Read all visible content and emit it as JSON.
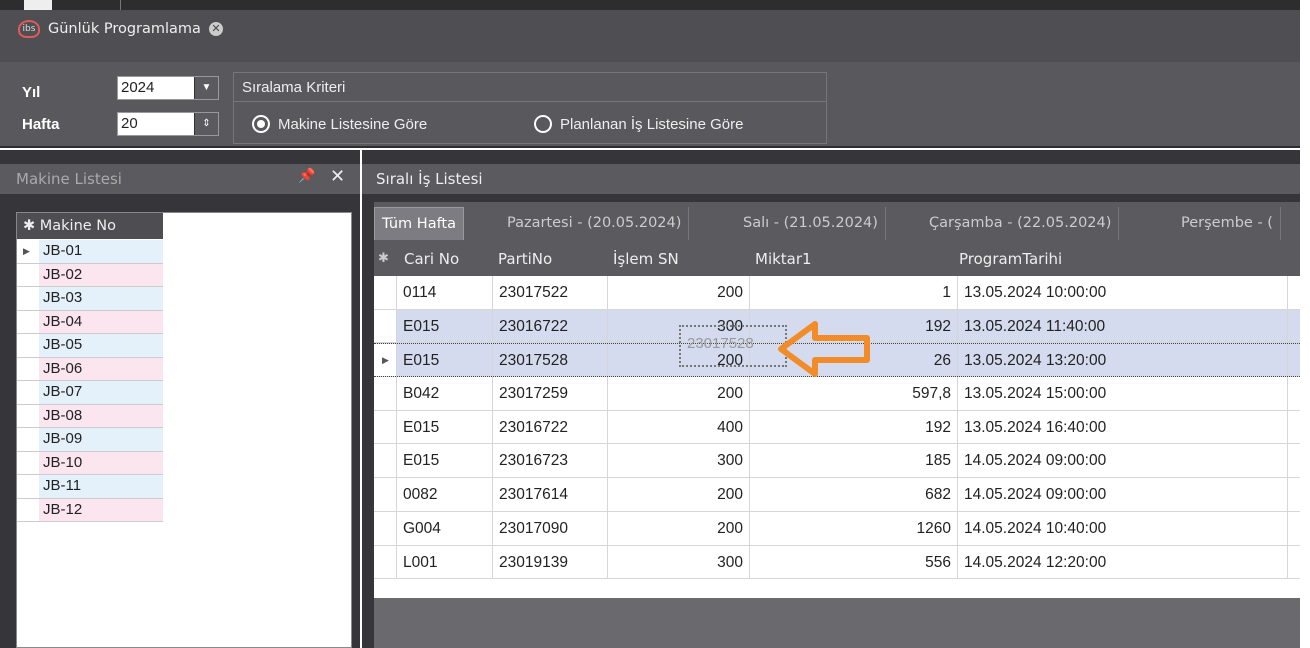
{
  "doc_tab": {
    "logo_text": "ibs",
    "title": "Günlük Programlama",
    "close_glyph": "✕"
  },
  "filters": {
    "year_label": "Yıl",
    "year_value": "2024",
    "week_label": "Hafta",
    "week_value": "20",
    "sort_title": "Sıralama Kriteri",
    "sort_options": [
      {
        "label": "Makine Listesine Göre",
        "selected": true
      },
      {
        "label": "Planlanan İş Listesine Göre",
        "selected": false
      }
    ]
  },
  "machine_panel": {
    "title": "Makine Listesi",
    "column": "Makine No",
    "rows": [
      "JB-01",
      "JB-02",
      "JB-03",
      "JB-04",
      "JB-05",
      "JB-06",
      "JB-07",
      "JB-08",
      "JB-09",
      "JB-10",
      "JB-11",
      "JB-12"
    ]
  },
  "job_panel": {
    "title": "Sıralı İş Listesi",
    "tabs": [
      "Tüm Hafta",
      "Pazartesi - (20.05.2024)",
      "Salı - (21.05.2024)",
      "Çarşamba - (22.05.2024)",
      "Perşembe - ("
    ],
    "columns": [
      "Cari No",
      "PartiNo",
      "İşlem SN",
      "Miktar1",
      "ProgramTarihi"
    ],
    "rows": [
      {
        "cari": "0114",
        "parti": "23017522",
        "islem": "200",
        "miktar": "1",
        "tarih": "13.05.2024 10:00:00"
      },
      {
        "cari": "E015",
        "parti": "23016722",
        "islem": "300",
        "miktar": "192",
        "tarih": "13.05.2024 11:40:00"
      },
      {
        "cari": "E015",
        "parti": "23017528",
        "islem": "200",
        "miktar": "26",
        "tarih": "13.05.2024 13:20:00"
      },
      {
        "cari": "B042",
        "parti": "23017259",
        "islem": "200",
        "miktar": "597,8",
        "tarih": "13.05.2024 15:00:00"
      },
      {
        "cari": "E015",
        "parti": "23016722",
        "islem": "400",
        "miktar": "192",
        "tarih": "13.05.2024 16:40:00"
      },
      {
        "cari": "E015",
        "parti": "23016723",
        "islem": "300",
        "miktar": "185",
        "tarih": "14.05.2024 09:00:00"
      },
      {
        "cari": "0082",
        "parti": "23017614",
        "islem": "200",
        "miktar": "682",
        "tarih": "14.05.2024 09:00:00"
      },
      {
        "cari": "G004",
        "parti": "23017090",
        "islem": "200",
        "miktar": "1260",
        "tarih": "14.05.2024 10:40:00"
      },
      {
        "cari": "L001",
        "parti": "23019139",
        "islem": "300",
        "miktar": "556",
        "tarih": "14.05.2024 12:20:00"
      }
    ],
    "drag_ghost_text": "23017528"
  },
  "colors": {
    "accent_arrow": "#f28c28",
    "logo_ring": "#e05b5b"
  }
}
